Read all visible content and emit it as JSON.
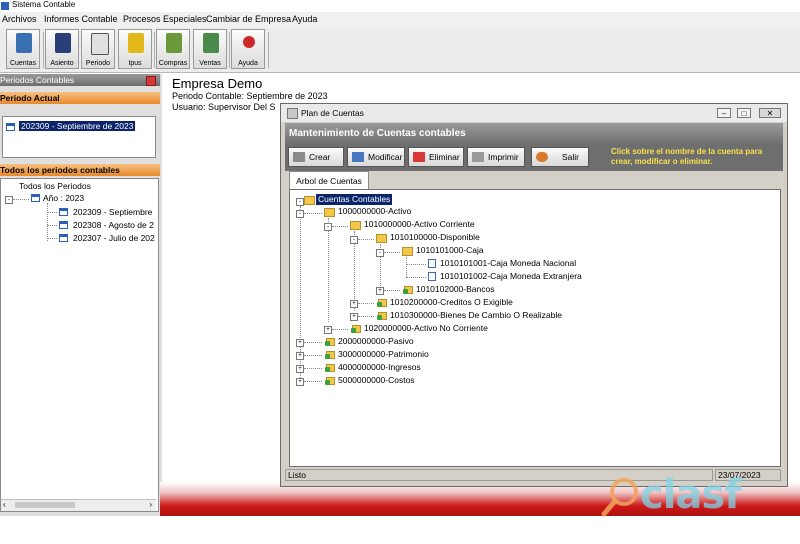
{
  "app": {
    "title": "Sistema Contable"
  },
  "menu": [
    "Archivos",
    "Informes Contable",
    "Procesos Especiales",
    "Cambiar de Empresa",
    "Ayuda"
  ],
  "toolbar": [
    {
      "label": "Cuentas",
      "icon": "accounts-icon",
      "color": "#3a6fb0"
    },
    {
      "label": "Asiento",
      "icon": "entry-icon",
      "color": "#2c3e7a"
    },
    {
      "label": "Periodo",
      "icon": "period-icon",
      "color": "#e0e0e0"
    },
    {
      "label": "Ipus",
      "icon": "money-icon",
      "color": "#e2b81c"
    },
    {
      "label": "Compras",
      "icon": "purchases-icon",
      "color": "#6a9a3a"
    },
    {
      "label": "Ventas",
      "icon": "sales-icon",
      "color": "#4a8a4a"
    },
    {
      "label": "Ayuda",
      "icon": "help-icon",
      "color": "#cc2a2a"
    }
  ],
  "left_panel": {
    "title": "Periodos Contables",
    "current_header": "Periodo Actual",
    "current_period": "202309 - Septiembre de 2023",
    "all_header": "Todos los periodos contables",
    "tree_root": "Todos los Periodos",
    "year_node": "Año : 2023",
    "periods": [
      "202309 - Septiembre",
      "202308 - Agosto de 2",
      "202307 - Julio de 202"
    ]
  },
  "main": {
    "company": "Empresa Demo",
    "period_line": "Periodo Contable: Septiembre de 2023",
    "user_line": "Usuario: Supervisor Del S"
  },
  "dialog": {
    "title": "Plan de Cuentas",
    "header": "Mantenimiento de Cuentas contables",
    "buttons": [
      {
        "label": "Crear",
        "icon": "create-icon"
      },
      {
        "label": "Modificar",
        "icon": "edit-icon"
      },
      {
        "label": "Eliminar",
        "icon": "delete-icon"
      },
      {
        "label": "Imprimir",
        "icon": "print-icon"
      },
      {
        "label": "Salir",
        "icon": "exit-icon"
      }
    ],
    "hint": "Click sobre el nombre de la cuenta para crear, modificar o eliminar.",
    "tab": "Arbol de Cuentas",
    "tree": [
      {
        "label": "Cuentas Contables"
      },
      {
        "label": "1000000000-Activo"
      },
      {
        "label": "1010000000-Activo Corriente"
      },
      {
        "label": "1010100000-Disponible"
      },
      {
        "label": "1010101000-Caja"
      },
      {
        "label": "1010101001-Caja Moneda Nacional"
      },
      {
        "label": "1010101002-Caja Moneda Extranjera"
      },
      {
        "label": "1010102000-Bancos"
      },
      {
        "label": "1010200000-Creditos O Exigible"
      },
      {
        "label": "1010300000-Bienes De Cambio O Realizable"
      },
      {
        "label": "1020000000-Activo No Corriente"
      },
      {
        "label": "2000000000-Pasivo"
      },
      {
        "label": "3000000000-Patrimonio"
      },
      {
        "label": "4000000000-Ingresos"
      },
      {
        "label": "5000000000-Costos"
      }
    ],
    "status_left": "Listo",
    "status_right": "23/07/2023"
  },
  "watermark": "clasf"
}
